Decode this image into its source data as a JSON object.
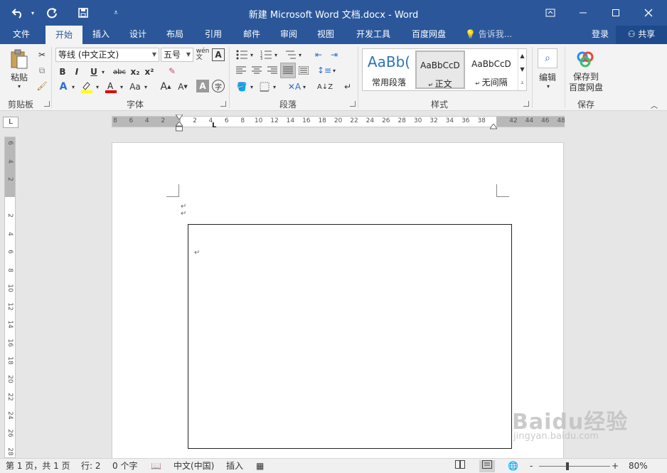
{
  "titlebar": {
    "title": "新建 Microsoft Word 文档.docx - Word",
    "undo_icon": "undo-icon",
    "redo_icon": "redo-icon",
    "save_icon": "save-icon",
    "customize_icon": "customize-qat-icon",
    "ribbon_display_icon": "ribbon-display-options-icon",
    "minimize_icon": "minimize-icon",
    "maximize_icon": "maximize-icon",
    "close_icon": "close-icon"
  },
  "tabs": [
    {
      "label": "文件"
    },
    {
      "label": "开始"
    },
    {
      "label": "插入"
    },
    {
      "label": "设计"
    },
    {
      "label": "布局"
    },
    {
      "label": "引用"
    },
    {
      "label": "邮件"
    },
    {
      "label": "审阅"
    },
    {
      "label": "视图"
    },
    {
      "label": "开发工具"
    },
    {
      "label": "百度网盘"
    }
  ],
  "active_tab": "开始",
  "tellme": "告诉我...",
  "login": "登录",
  "share": "共享",
  "ribbon": {
    "clipboard": {
      "label": "剪贴板",
      "paste": "粘贴"
    },
    "font": {
      "label": "字体",
      "font_name": "等线 (中文正文)",
      "font_size": "五号",
      "bold": "B",
      "italic": "I",
      "underline": "U",
      "strike": "abc",
      "subscript": "x₂",
      "superscript": "x²",
      "case": "Aa",
      "grow": "A",
      "shrink": "A",
      "clear": "A",
      "phonetic": "wén文",
      "enclose": "字"
    },
    "paragraph": {
      "label": "段落"
    },
    "styles": {
      "label": "样式",
      "items": [
        {
          "preview": "AaBb(",
          "name": "常用段落"
        },
        {
          "preview": "AaBbCcD",
          "name": "正文"
        },
        {
          "preview": "AaBbCcD",
          "name": "无间隔"
        }
      ]
    },
    "editing": {
      "label": "编辑"
    },
    "save": {
      "label": "保存",
      "button_line1": "保存到",
      "button_line2": "百度网盘"
    }
  },
  "ruler": {
    "corner": "L",
    "ticks": [
      "8",
      "6",
      "4",
      "2",
      "",
      "2",
      "4",
      "6",
      "8",
      "10",
      "12",
      "14",
      "16",
      "18",
      "20",
      "22",
      "24",
      "26",
      "28",
      "30",
      "32",
      "34",
      "36",
      "38",
      "",
      "42",
      "44",
      "46",
      "48"
    ],
    "vticks": [
      "6",
      "4",
      "2",
      "",
      "2",
      "4",
      "6",
      "8",
      "10",
      "12",
      "14",
      "16",
      "18",
      "20",
      "22",
      "24",
      "26",
      "28"
    ]
  },
  "document": {
    "para_mark": "↵"
  },
  "statusbar": {
    "page": "第 1 页，共 1 页",
    "line": "行: 2",
    "words": "0 个字",
    "language": "中文(中国)",
    "mode": "插入",
    "zoom": "80%",
    "zoom_minus": "-",
    "zoom_plus": "+"
  },
  "watermark": {
    "line1": "Baidu经验",
    "line2": "jingyan.baidu.com"
  }
}
